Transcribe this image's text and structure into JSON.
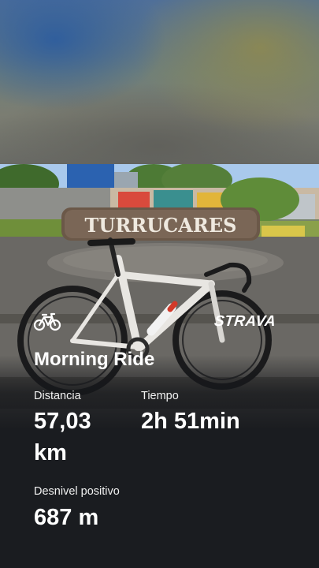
{
  "activity": {
    "sport_icon": "bicycle-icon",
    "brand": "STRAVA",
    "title": "Morning Ride"
  },
  "photo": {
    "sign_text": "TURRUCARES"
  },
  "stats": {
    "distance_label": "Distancia",
    "distance_value_line1": "57,03",
    "distance_value_line2": "km",
    "time_label": "Tiempo",
    "time_value": "2h 51min",
    "elevation_label": "Desnivel positivo",
    "elevation_value": "687 m"
  },
  "colors": {
    "text": "#ffffff",
    "background": "#1a1c20"
  }
}
